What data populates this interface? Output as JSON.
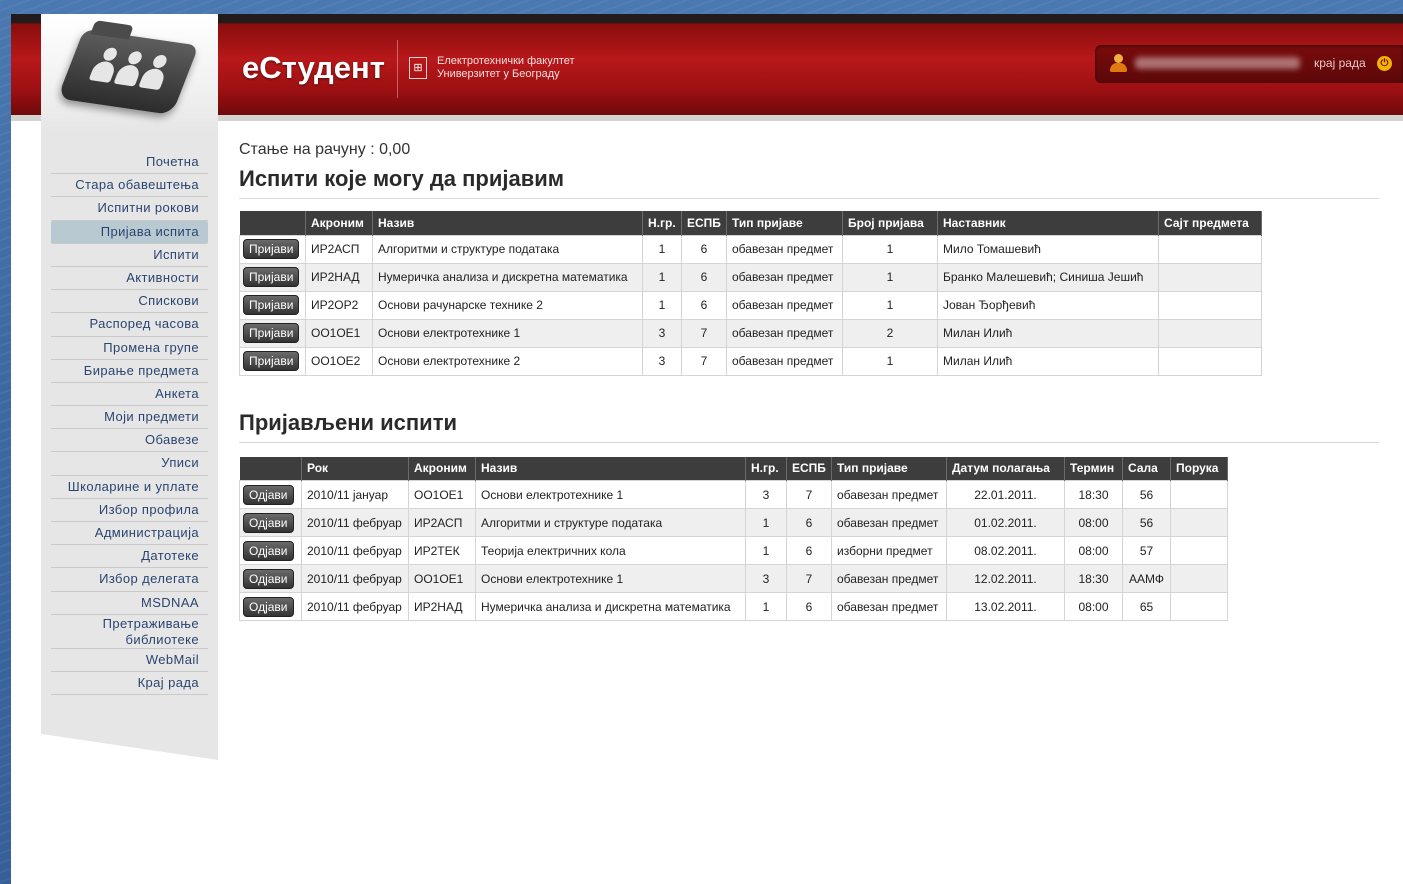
{
  "header": {
    "brand": "еСтудент",
    "faculty_line1": "Електротехнички факултет",
    "faculty_line2": "Универзитет у Београду",
    "logout_label": "крај рада"
  },
  "sidebar": {
    "items": [
      {
        "label": "Почетна"
      },
      {
        "label": "Стара обавештења"
      },
      {
        "label": "Испитни рокови"
      },
      {
        "label": "Пријава испита",
        "active": true
      },
      {
        "label": "Испити"
      },
      {
        "label": "Активности"
      },
      {
        "label": "Спискови"
      },
      {
        "label": "Распоред часова"
      },
      {
        "label": "Промена групе"
      },
      {
        "label": "Бирање предмета"
      },
      {
        "label": "Анкета"
      },
      {
        "label": "Моји предмети"
      },
      {
        "label": "Обавезе"
      },
      {
        "label": "Уписи"
      },
      {
        "label": "Школарине и уплате"
      },
      {
        "label": "Избор профила"
      },
      {
        "label": "Администрација"
      },
      {
        "label": "Датотеке"
      },
      {
        "label": "Избор делегата"
      },
      {
        "label": "MSDNAA"
      },
      {
        "label": "Претраживање библиотеке"
      },
      {
        "label": "WebMail"
      },
      {
        "label": "Крај рада"
      }
    ]
  },
  "main": {
    "balance": "Стање на рачуну : 0,00",
    "available_title": "Испити које могу да пријавим",
    "available_table": {
      "headers": [
        "",
        "Акроним",
        "Назив",
        "Н.гр.",
        "ЕСПБ",
        "Тип пријаве",
        "Број пријава",
        "Наставник",
        "Сајт предмета"
      ],
      "rows": [
        {
          "action": "Пријави",
          "acronym": "ИР2АСП",
          "name": "Алгоритми и структуре података",
          "group": "1",
          "espb": "6",
          "type": "обавезан предмет",
          "count": "1",
          "teacher": "Мило Томашевић",
          "site": ""
        },
        {
          "action": "Пријави",
          "acronym": "ИР2НАД",
          "name": "Нумеричка анализа и дискретна математика",
          "group": "1",
          "espb": "6",
          "type": "обавезан предмет",
          "count": "1",
          "teacher": "Бранко Малешевић; Синиша Јешић",
          "site": ""
        },
        {
          "action": "Пријави",
          "acronym": "ИР2ОР2",
          "name": "Основи рачунарске технике 2",
          "group": "1",
          "espb": "6",
          "type": "обавезан предмет",
          "count": "1",
          "teacher": "Јован Ђорђевић",
          "site": ""
        },
        {
          "action": "Пријави",
          "acronym": "ОО1ОЕ1",
          "name": "Основи електротехнике 1",
          "group": "3",
          "espb": "7",
          "type": "обавезан предмет",
          "count": "2",
          "teacher": "Милан Илић",
          "site": ""
        },
        {
          "action": "Пријави",
          "acronym": "ОО1ОЕ2",
          "name": "Основи електротехнике 2",
          "group": "3",
          "espb": "7",
          "type": "обавезан предмет",
          "count": "1",
          "teacher": "Милан Илић",
          "site": ""
        }
      ]
    },
    "registered_title": "Пријављени испити",
    "registered_table": {
      "headers": [
        "",
        "Рок",
        "Акроним",
        "Назив",
        "Н.гр.",
        "ЕСПБ",
        "Тип пријаве",
        "Датум полагања",
        "Термин",
        "Сала",
        "Порука"
      ],
      "rows": [
        {
          "action": "Одјави",
          "term": "2010/11 јануар",
          "acronym": "ОО1ОЕ1",
          "name": "Основи електротехнике 1",
          "group": "3",
          "espb": "7",
          "type": "обавезан предмет",
          "date": "22.01.2011.",
          "time": "18:30",
          "room": "56",
          "msg": ""
        },
        {
          "action": "Одјави",
          "term": "2010/11 фебруар",
          "acronym": "ИР2АСП",
          "name": "Алгоритми и структуре података",
          "group": "1",
          "espb": "6",
          "type": "обавезан предмет",
          "date": "01.02.2011.",
          "time": "08:00",
          "room": "56",
          "msg": ""
        },
        {
          "action": "Одјави",
          "term": "2010/11 фебруар",
          "acronym": "ИР2ТЕК",
          "name": "Теорија електричних кола",
          "group": "1",
          "espb": "6",
          "type": "изборни предмет",
          "date": "08.02.2011.",
          "time": "08:00",
          "room": "57",
          "msg": ""
        },
        {
          "action": "Одјави",
          "term": "2010/11 фебруар",
          "acronym": "ОО1ОЕ1",
          "name": "Основи електротехнике 1",
          "group": "3",
          "espb": "7",
          "type": "обавезан предмет",
          "date": "12.02.2011.",
          "time": "18:30",
          "room": "ААМФ",
          "msg": ""
        },
        {
          "action": "Одјави",
          "term": "2010/11 фебруар",
          "acronym": "ИР2НАД",
          "name": "Нумеричка анализа и дискретна математика",
          "group": "1",
          "espb": "6",
          "type": "обавезан предмет",
          "date": "13.02.2011.",
          "time": "08:00",
          "room": "65",
          "msg": ""
        }
      ]
    }
  },
  "colors": {
    "header_red": "#b8181a",
    "table_header": "#3d3d3d",
    "active_nav": "#b8c9d1",
    "nav_text": "#2b4570"
  },
  "icons": [
    "users-folder-icon",
    "user-icon",
    "power-icon",
    "faculty-logo-icon"
  ]
}
